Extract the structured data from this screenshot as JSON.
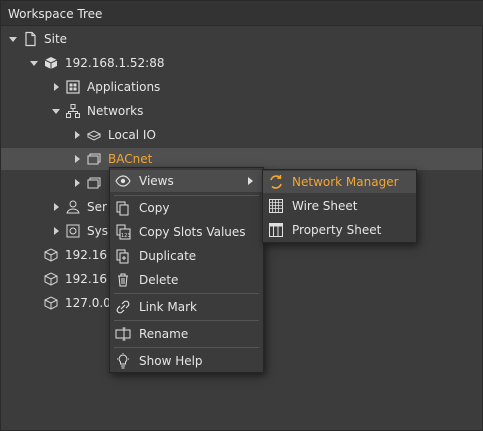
{
  "panel": {
    "title": "Workspace Tree"
  },
  "tree": {
    "site": "Site",
    "station": "192.168.1.52:88",
    "applications": "Applications",
    "networks": "Networks",
    "local_io": "Local IO",
    "bacnet": "BACnet",
    "services_partial": "Ser",
    "system_partial": "Sys",
    "station2_partial": "192.16",
    "station3_partial": "192.16",
    "station4_partial": "127.0.0"
  },
  "context_menu": {
    "views": "Views",
    "copy": "Copy",
    "copy_slots": "Copy Slots Values",
    "duplicate": "Duplicate",
    "delete": "Delete",
    "link_mark": "Link Mark",
    "rename": "Rename",
    "show_help": "Show Help"
  },
  "submenu": {
    "network_manager": "Network Manager",
    "wire_sheet": "Wire Sheet",
    "property_sheet": "Property Sheet"
  },
  "colors": {
    "accent": "#f3a733",
    "background": "#3c3c3c",
    "selected": "#505050"
  }
}
